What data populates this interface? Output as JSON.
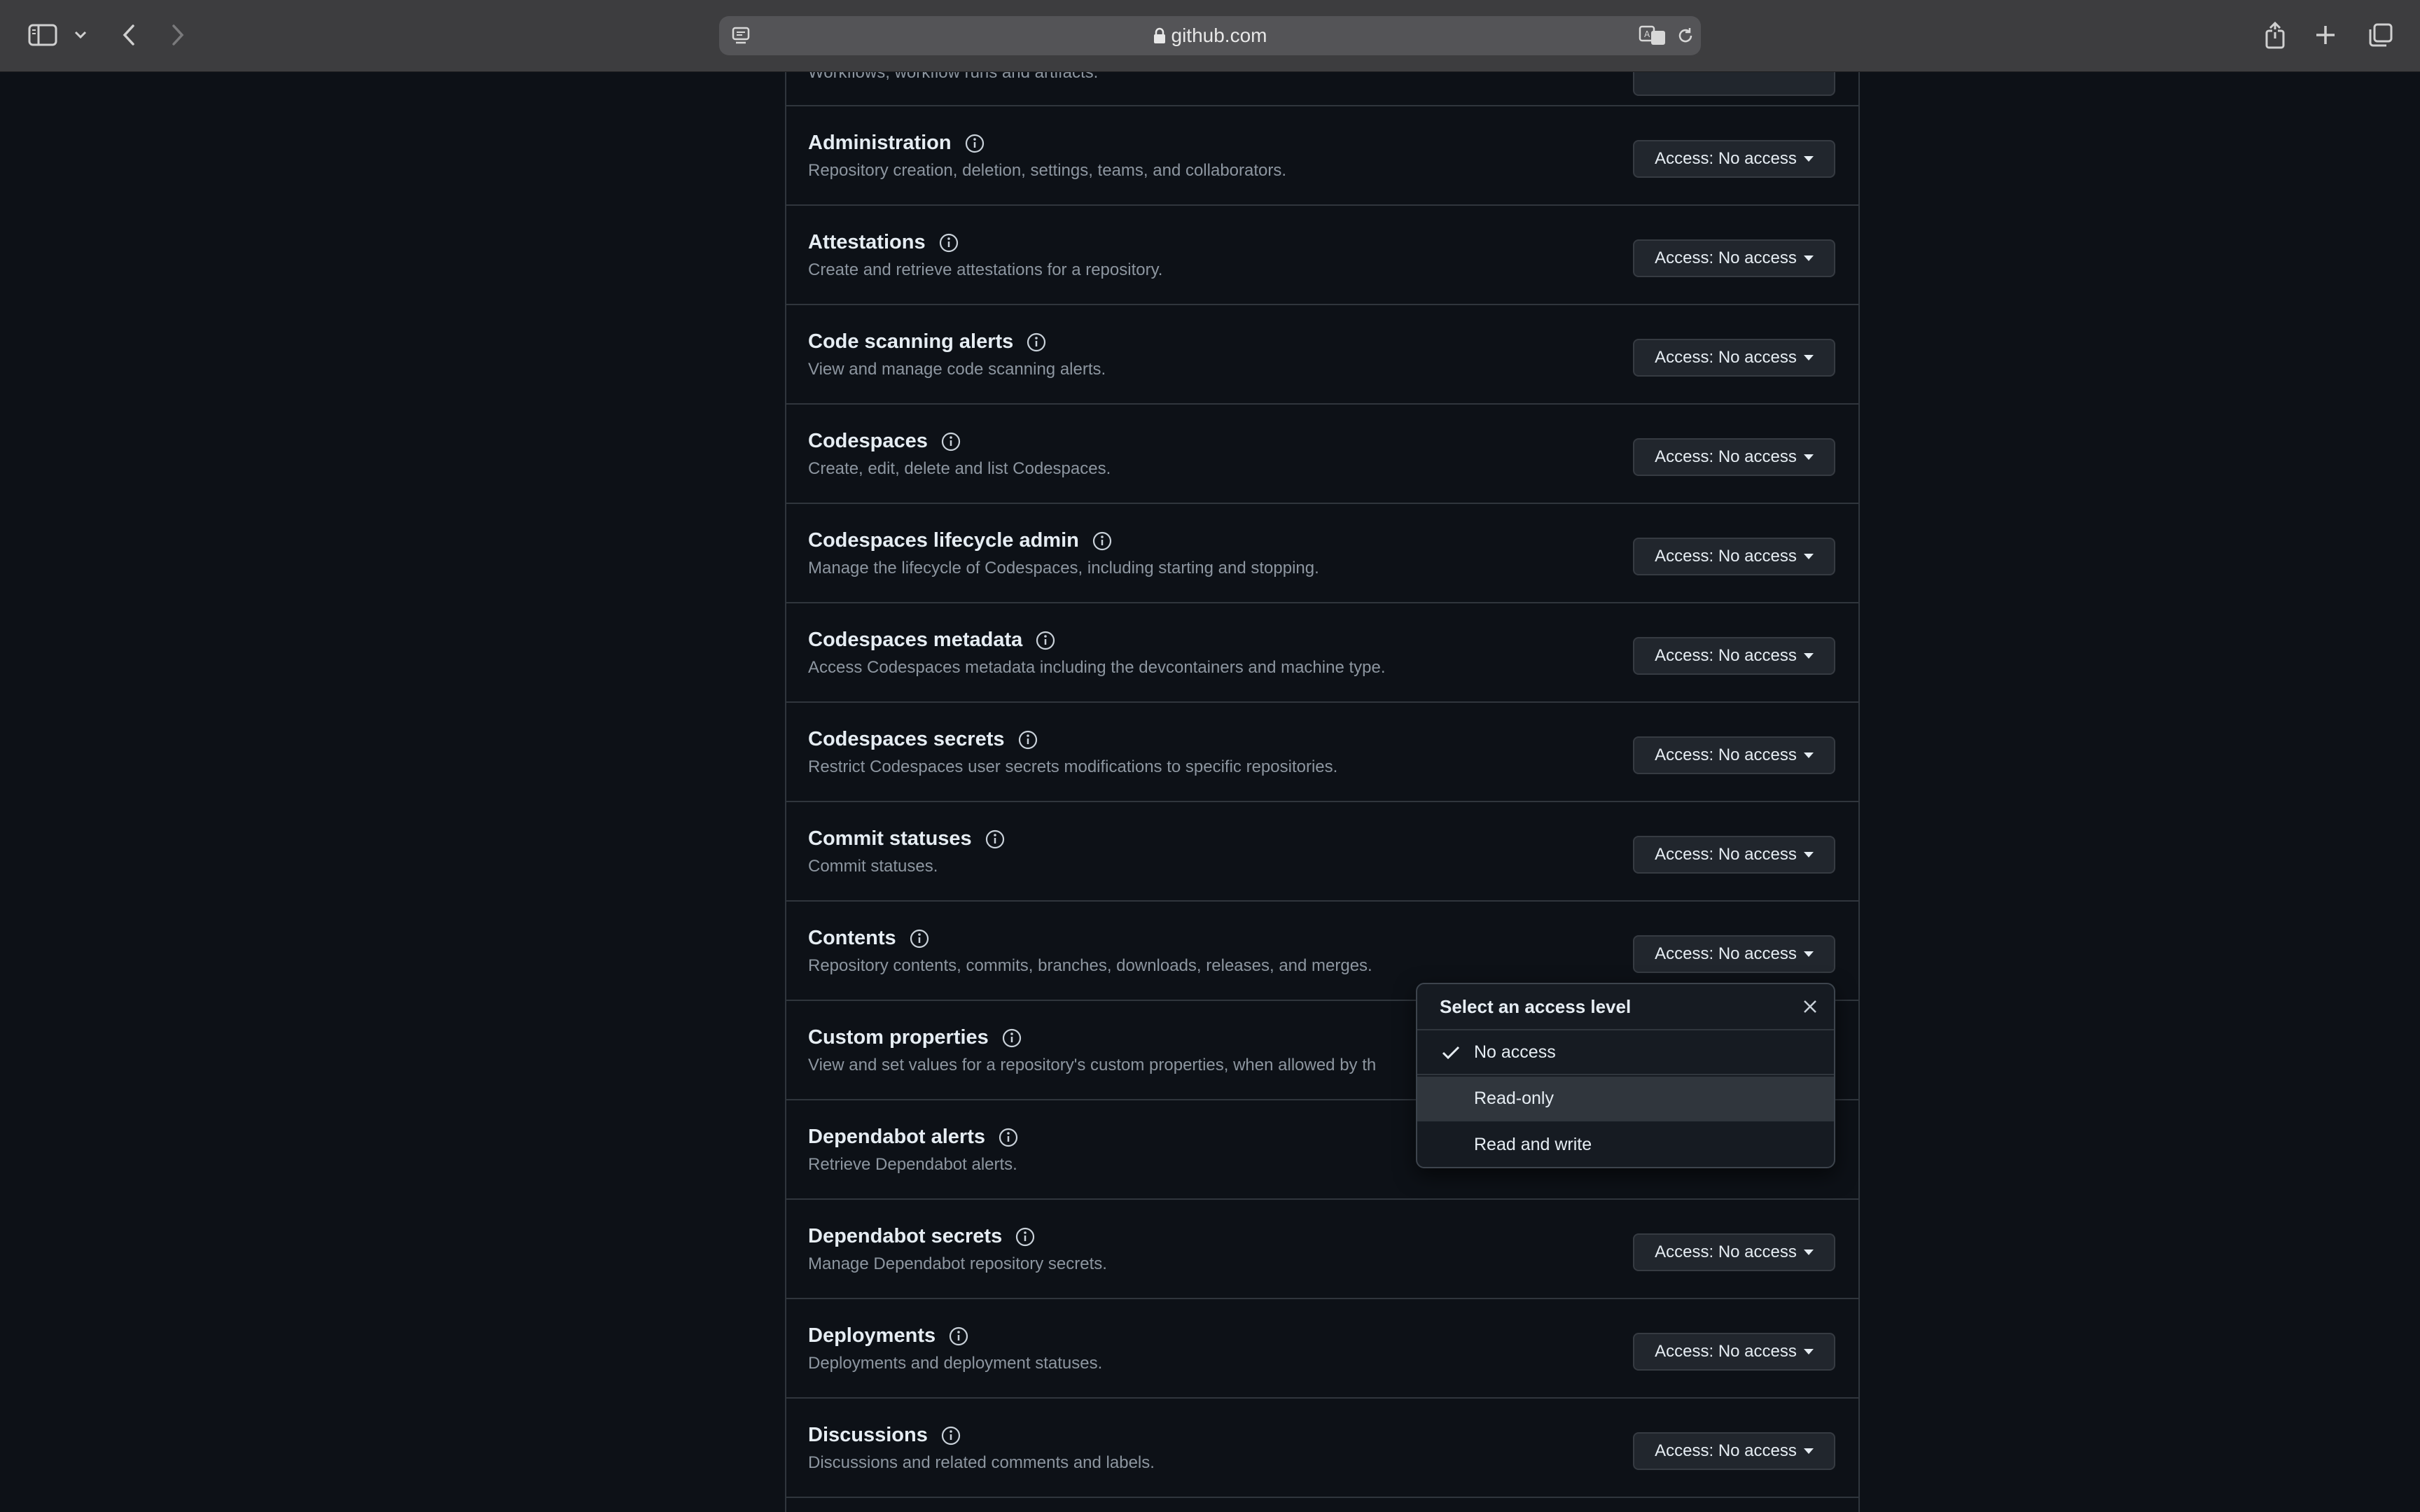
{
  "browser": {
    "url": "github.com"
  },
  "permissions": [
    {
      "title": "",
      "desc": "Workflows, workflow runs and artifacts.",
      "access": ""
    },
    {
      "title": "Administration",
      "desc": "Repository creation, deletion, settings, teams, and collaborators.",
      "access": "Access: No access"
    },
    {
      "title": "Attestations",
      "desc": "Create and retrieve attestations for a repository.",
      "access": "Access: No access"
    },
    {
      "title": "Code scanning alerts",
      "desc": "View and manage code scanning alerts.",
      "access": "Access: No access"
    },
    {
      "title": "Codespaces",
      "desc": "Create, edit, delete and list Codespaces.",
      "access": "Access: No access"
    },
    {
      "title": "Codespaces lifecycle admin",
      "desc": "Manage the lifecycle of Codespaces, including starting and stopping.",
      "access": "Access: No access"
    },
    {
      "title": "Codespaces metadata",
      "desc": "Access Codespaces metadata including the devcontainers and machine type.",
      "access": "Access: No access"
    },
    {
      "title": "Codespaces secrets",
      "desc": "Restrict Codespaces user secrets modifications to specific repositories.",
      "access": "Access: No access"
    },
    {
      "title": "Commit statuses",
      "desc": "Commit statuses.",
      "access": "Access: No access"
    },
    {
      "title": "Contents",
      "desc": "Repository contents, commits, branches, downloads, releases, and merges.",
      "access": "Access: No access"
    },
    {
      "title": "Custom properties",
      "desc": "View and set values for a repository's custom properties, when allowed by th",
      "access": ""
    },
    {
      "title": "Dependabot alerts",
      "desc": "Retrieve Dependabot alerts.",
      "access": ""
    },
    {
      "title": "Dependabot secrets",
      "desc": "Manage Dependabot repository secrets.",
      "access": "Access: No access"
    },
    {
      "title": "Deployments",
      "desc": "Deployments and deployment statuses.",
      "access": "Access: No access"
    },
    {
      "title": "Discussions",
      "desc": "Discussions and related comments and labels.",
      "access": "Access: No access"
    }
  ],
  "dropdown": {
    "title": "Select an access level",
    "options": [
      {
        "label": "No access",
        "selected": true
      },
      {
        "label": "Read-only",
        "selected": false
      },
      {
        "label": "Read and write",
        "selected": false
      }
    ]
  }
}
